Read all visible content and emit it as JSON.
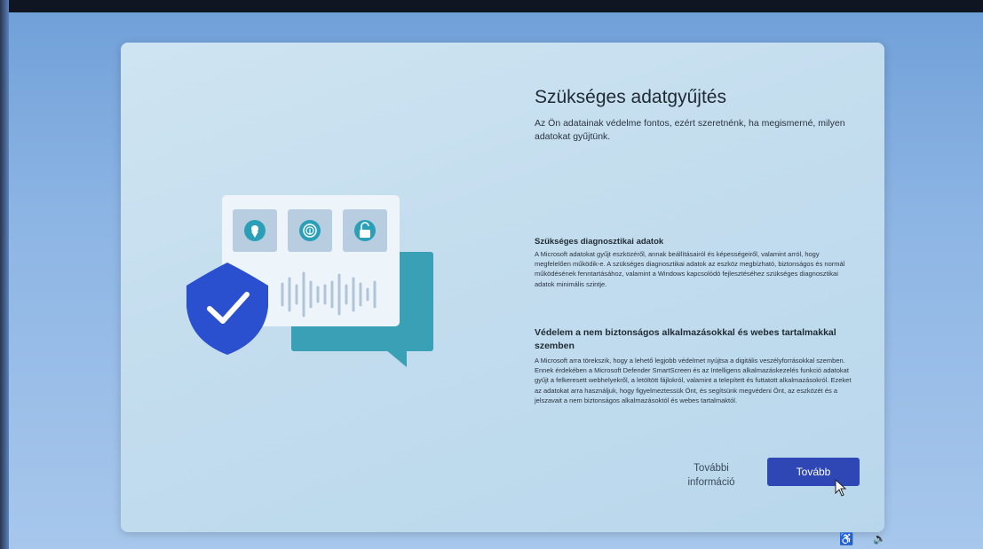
{
  "page": {
    "title": "Szükséges adatgyűjtés",
    "intro": "Az Ön adatainak védelme fontos, ezért szeretnénk, ha megismerné, milyen adatokat gyűjtünk."
  },
  "sections": [
    {
      "heading": "Szükséges diagnosztikai adatok",
      "body": "A Microsoft adatokat gyűjt eszközéről, annak beállításairól és képességeiről, valamint arról, hogy megfelelően működik-e. A szükséges diagnosztikai adatok az eszköz megbízható, biztonságos és normál működésének fenntartásához, valamint a Windows kapcsolódó fejlesztéséhez szükséges diagnosztikai adatok minimális szintje."
    },
    {
      "heading": "Védelem a nem biztonságos alkalmazásokkal és webes tartalmakkal szemben",
      "body": "A Microsoft arra törekszik, hogy a lehető legjobb védelmet nyújtsa a digitális veszélyforrásokkal szemben. Ennek érdekében a Microsoft Defender SmartScreen és az Intelligens alkalmazáskezelés funkció adatokat gyűjt a felkeresett webhelyekről, a letöltött fájlokról, valamint a telepített és futtatott alkalmazásokról. Ezeket az adatokat arra használjuk, hogy figyelmeztessük Önt, és segítsünk megvédeni Önt, az eszközét és a jelszavait a nem biztonságos alkalmazásoktól és webes tartalmaktól."
    }
  ],
  "buttons": {
    "more_info": "További információ",
    "next": "Tovább"
  },
  "colors": {
    "accent": "#2f46b5",
    "shield": "#2a4fcf",
    "bubble": "#3aa0b5",
    "card": "#c5def0"
  },
  "icons": [
    "location-pin-icon",
    "fingerprint-icon",
    "unlock-icon",
    "shield-check-icon",
    "accessibility-icon",
    "volume-icon"
  ]
}
